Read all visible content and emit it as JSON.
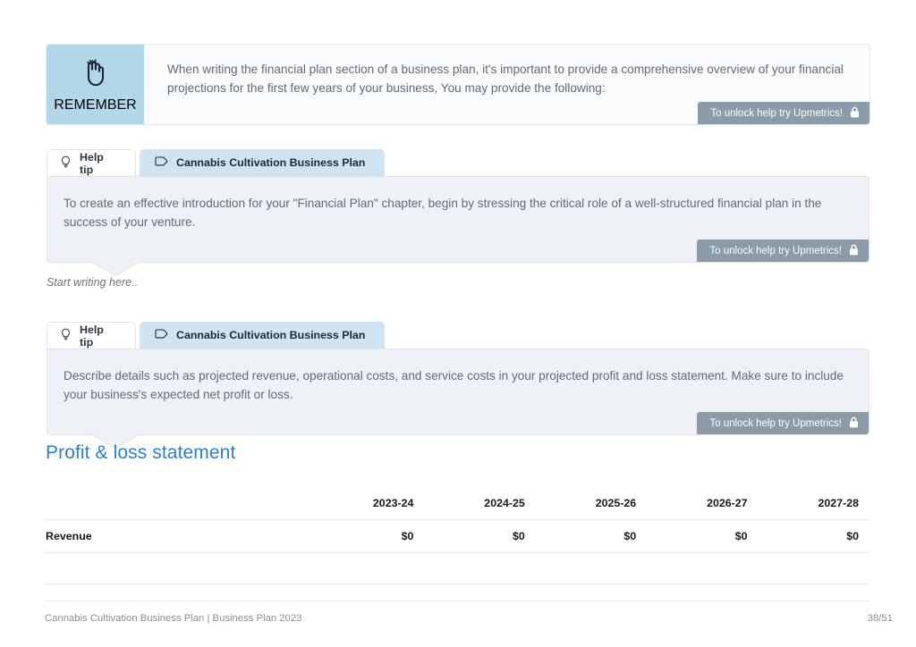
{
  "remember": {
    "label": "REMEMBER",
    "icon": "hand-with-string-icon",
    "text": "When writing the financial plan section of a business plan, it's important to provide a comprehensive overview of your financial projections for the first few years of your business, You may provide the following:",
    "panel_color": "#b2d7e8",
    "unlock": {
      "label": "To unlock help try Upmetrics!",
      "icon": "lock-icon"
    }
  },
  "tips": [
    {
      "tabs": [
        {
          "label": "Help tip",
          "icon": "lightbulb-icon",
          "active": false
        },
        {
          "label": "Cannabis Cultivation Business Plan",
          "icon": "tag-icon",
          "active": true
        }
      ],
      "text": "To create an effective introduction for your \"Financial Plan\" chapter, begin by stressing the critical role of a well-structured financial plan in the success of your venture.",
      "unlock": {
        "label": "To unlock help try Upmetrics!",
        "icon": "lock-icon"
      }
    },
    {
      "tabs": [
        {
          "label": "Help tip",
          "icon": "lightbulb-icon",
          "active": false
        },
        {
          "label": "Cannabis Cultivation Business Plan",
          "icon": "tag-icon",
          "active": true
        }
      ],
      "text": "Describe details such as projected revenue, operational costs, and service costs in your projected profit and loss statement. Make sure to include your business's expected net profit or loss.",
      "unlock": {
        "label": "To unlock help try Upmetrics!",
        "icon": "lock-icon"
      }
    }
  ],
  "editor": {
    "placeholder": "Start writing here.."
  },
  "section": {
    "heading": "Profit & loss statement",
    "accent_color": "#2e80c4"
  },
  "table": {
    "row_label_header": "",
    "columns": [
      "2023-24",
      "2024-25",
      "2025-26",
      "2026-27",
      "2027-28"
    ],
    "rows": [
      {
        "label": "Revenue",
        "values": [
          "$0",
          "$0",
          "$0",
          "$0",
          "$0"
        ]
      }
    ]
  },
  "footer": {
    "left": "Cannabis Cultivation Business Plan | Business Plan 2023",
    "right": "38/51"
  }
}
